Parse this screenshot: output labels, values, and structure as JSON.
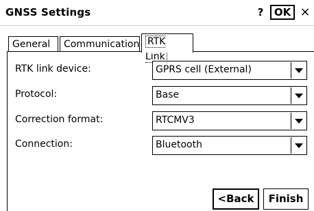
{
  "window": {
    "title": "GNSS Settings",
    "help_label": "?",
    "ok_label": "OK",
    "close_label": "×"
  },
  "tabs": [
    {
      "label": "General"
    },
    {
      "label": "Communication"
    },
    {
      "label": "RTK Link",
      "selected": true
    }
  ],
  "form": {
    "rtk_link_device": {
      "label": "RTK link device:",
      "value": "GPRS cell (External)"
    },
    "protocol": {
      "label": "Protocol:",
      "value": "Base"
    },
    "correction_format": {
      "label": "Correction format:",
      "value": "RTCMV3"
    },
    "connection": {
      "label": "Connection:",
      "value": "Bluetooth"
    }
  },
  "buttons": {
    "back_label": "<Back",
    "finish_label": "Finish"
  },
  "icons": {
    "dropdown": "chevron-down-icon"
  }
}
